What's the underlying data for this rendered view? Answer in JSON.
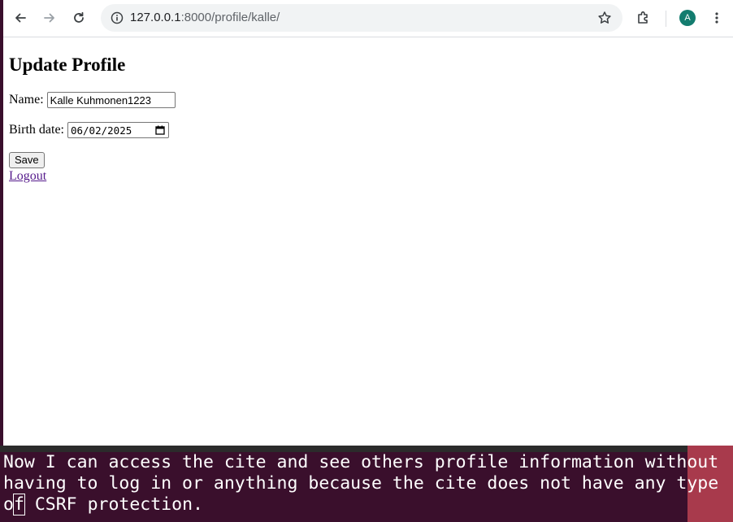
{
  "browser": {
    "url_host": "127.0.0.1",
    "url_rest": ":8000/profile/kalle/",
    "avatar_letter": "A",
    "accent_color": "#137c6f"
  },
  "page": {
    "heading": "Update Profile",
    "name_label": "Name:",
    "name_value": "Kalle Kuhmonen1223",
    "birth_label": "Birth date:",
    "birth_value": "06/02/2025",
    "save_label": "Save",
    "logout_label": "Logout"
  },
  "terminal": {
    "line1": "Now I can access the cite and see others profile information without",
    "line2": "having to log in or anything because the cite does not have any type",
    "line3_start": "o",
    "line3_cursor": "f",
    "line3_rest": " CSRF protection."
  }
}
